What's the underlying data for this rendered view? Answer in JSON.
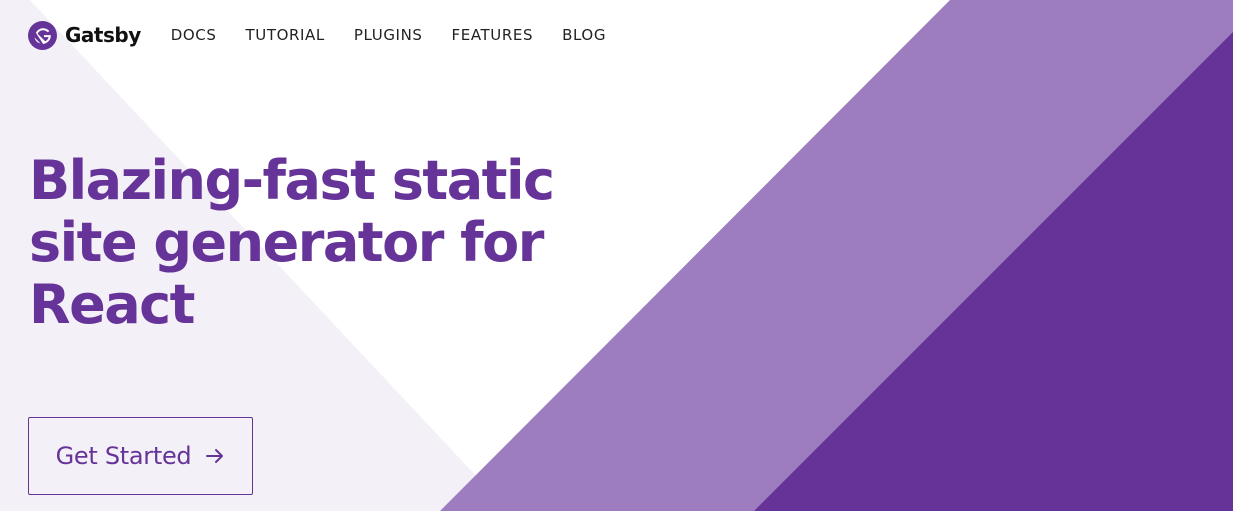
{
  "brand": {
    "name": "Gatsby",
    "logo_icon": "gatsby-logo-icon",
    "color": "#663399"
  },
  "nav": {
    "items": [
      {
        "label": "DOCS"
      },
      {
        "label": "TUTORIAL"
      },
      {
        "label": "PLUGINS"
      },
      {
        "label": "FEATURES"
      },
      {
        "label": "BLOG"
      }
    ]
  },
  "hero": {
    "title_lines": [
      "Blazing-fast static",
      "site generator for",
      "React"
    ],
    "cta_label": "Get Started",
    "cta_icon": "arrow-right-icon"
  },
  "colors": {
    "primary": "#663399",
    "light_purple": "#9d7cbf",
    "pale_lavender": "#f3f1f7",
    "background": "#ffffff"
  }
}
